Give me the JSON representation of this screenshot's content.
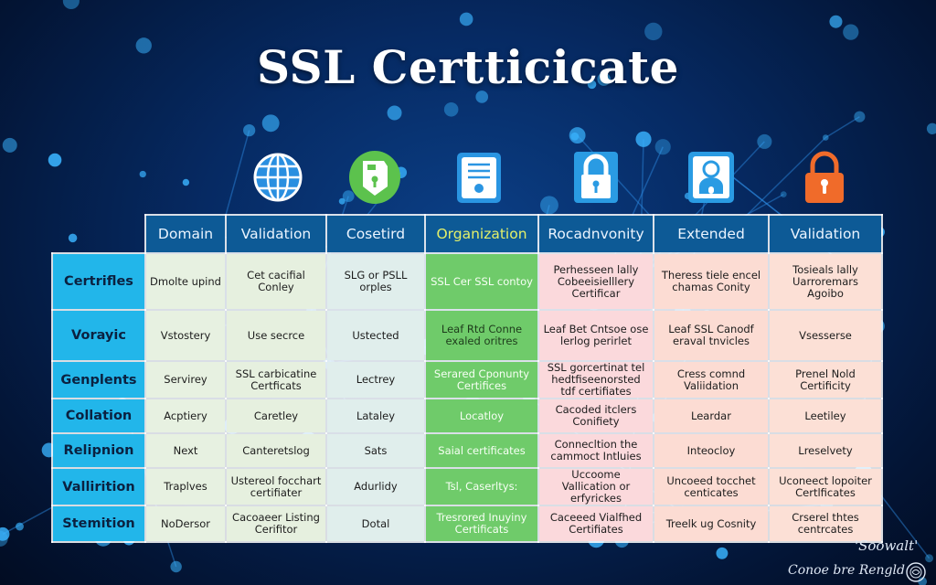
{
  "title": "SSL Certticicate",
  "icons": [
    {
      "name": "globe-icon"
    },
    {
      "name": "shield-keyhole-icon"
    },
    {
      "name": "certificate-document-icon"
    },
    {
      "name": "padlock-icon"
    },
    {
      "name": "user-id-badge-icon"
    },
    {
      "name": "orange-padlock-icon"
    }
  ],
  "table": {
    "columns": [
      "Domain",
      "Validation",
      "Cosetird",
      "Organization",
      "Rocadnvonity",
      "Extended",
      "Validation"
    ],
    "rows": [
      {
        "label": "Certrifles",
        "cells": [
          "Dmolte upind",
          "Cet cacifial Conley",
          "SLG or PSLL orples",
          "SSL Cer SSL contoy",
          "Perhesseen lally Cobeeisielllery Certificar",
          "Theress tiele encel chamas Conity",
          "Tosieals lally Uarroremars Agoibo"
        ]
      },
      {
        "label": "Vorayic",
        "cells": [
          "Vstostery",
          "Use secrce",
          "Ustected",
          "Leaf Rtd Conne exaled oritres",
          "Leaf Bet Cntsoe ose lerlog perirlet",
          "Leaf SSL Canodf eraval tnvicles",
          "Vsesserse"
        ]
      },
      {
        "label": "Genplents",
        "cells": [
          "Servirey",
          "SSL carbicatine Certficats",
          "Lectrey",
          "Serared Cponunty Certifices",
          "SSL gorcertinat tel hedtfiseenorsted tdf certifiates",
          "Cress comnd Valiidation",
          "Prenel Nold Certificity"
        ]
      },
      {
        "label": "Collation",
        "cells": [
          "Acptiery",
          "Caretley",
          "Lataley",
          "Locatloy",
          "Cacoded itclers Conifiety",
          "Leardar",
          "Leetiley"
        ]
      },
      {
        "label": "Relipnion",
        "cells": [
          "Next",
          "Canteretslog",
          "Sats",
          "Saial certificates",
          "Connecltion the cammoct Intluies",
          "Inteocloy",
          "Lreselvety"
        ]
      },
      {
        "label": "Vallirition",
        "cells": [
          "Traplves",
          "Ustereol focchart certifiater",
          "Adurlidy",
          "Tsl, Caserltys:",
          "Uccoome Vallication or erfyrickes",
          "Uncoeed tocchet centicates",
          "Uconeect lopoiter Certlficates"
        ]
      },
      {
        "label": "Stemition",
        "cells": [
          "NoDersor",
          "Cacoaeer Listing Cerifitor",
          "Dotal",
          "Tresrored Inuyiny Certificats",
          "Caceeed Vialfhed Certifiates",
          "Treelk ug Cosnity",
          "Crserel thtes centrcates"
        ]
      }
    ]
  },
  "signature": {
    "line1": "'Soowalt'",
    "line2": "Conoe bre Rengld"
  }
}
